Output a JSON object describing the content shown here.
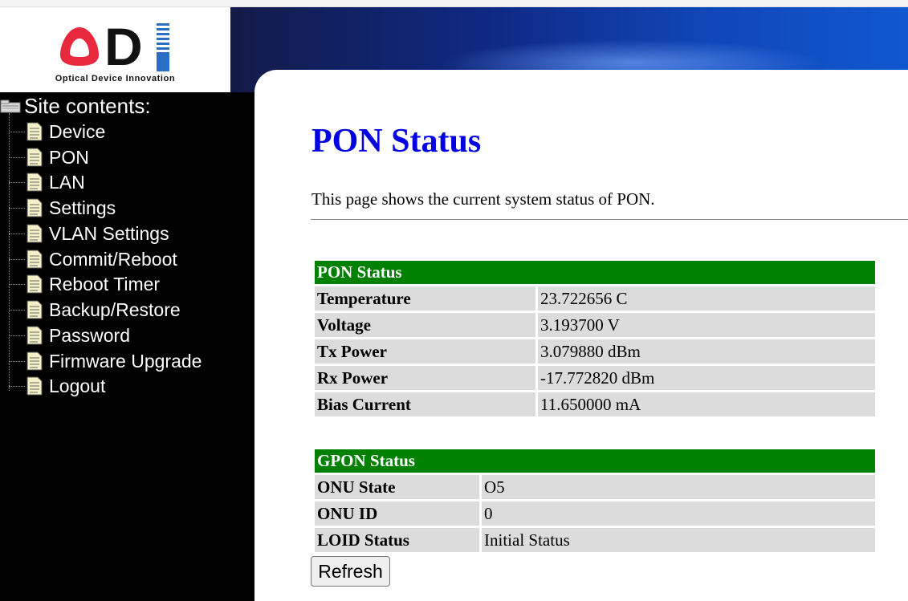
{
  "logo": {
    "letters": "ODI",
    "tagline": "Optical Device Innovation"
  },
  "sidebar": {
    "title": "Site contents:",
    "items": [
      {
        "label": "Device"
      },
      {
        "label": "PON"
      },
      {
        "label": "LAN"
      },
      {
        "label": "Settings"
      },
      {
        "label": "VLAN Settings"
      },
      {
        "label": "Commit/Reboot"
      },
      {
        "label": "Reboot Timer"
      },
      {
        "label": "Backup/Restore"
      },
      {
        "label": "Password"
      },
      {
        "label": "Firmware Upgrade"
      },
      {
        "label": "Logout"
      }
    ]
  },
  "main": {
    "title": "PON Status",
    "description": "This page shows the current system status of PON.",
    "pon_table": {
      "header": "PON Status",
      "rows": [
        {
          "label": "Temperature",
          "value": "23.722656 C"
        },
        {
          "label": "Voltage",
          "value": "3.193700 V"
        },
        {
          "label": "Tx Power",
          "value": "3.079880 dBm"
        },
        {
          "label": "Rx Power",
          "value": "-17.772820 dBm"
        },
        {
          "label": "Bias Current",
          "value": "11.650000 mA"
        }
      ]
    },
    "gpon_table": {
      "header": "GPON Status",
      "rows": [
        {
          "label": "ONU State",
          "value": "O5"
        },
        {
          "label": "ONU ID",
          "value": "0"
        },
        {
          "label": "LOID Status",
          "value": "Initial Status"
        }
      ]
    },
    "refresh_label": "Refresh"
  },
  "colors": {
    "title": "#0000e0",
    "table_header": "#008000",
    "table_cell": "#dcdcdc",
    "sidebar_bg": "#000000",
    "logo_red": "#e8283c",
    "logo_blue": "#2a6fc4"
  },
  "icons": {
    "tree_root": "folder-tree-icon",
    "tree_item": "document-icon"
  }
}
